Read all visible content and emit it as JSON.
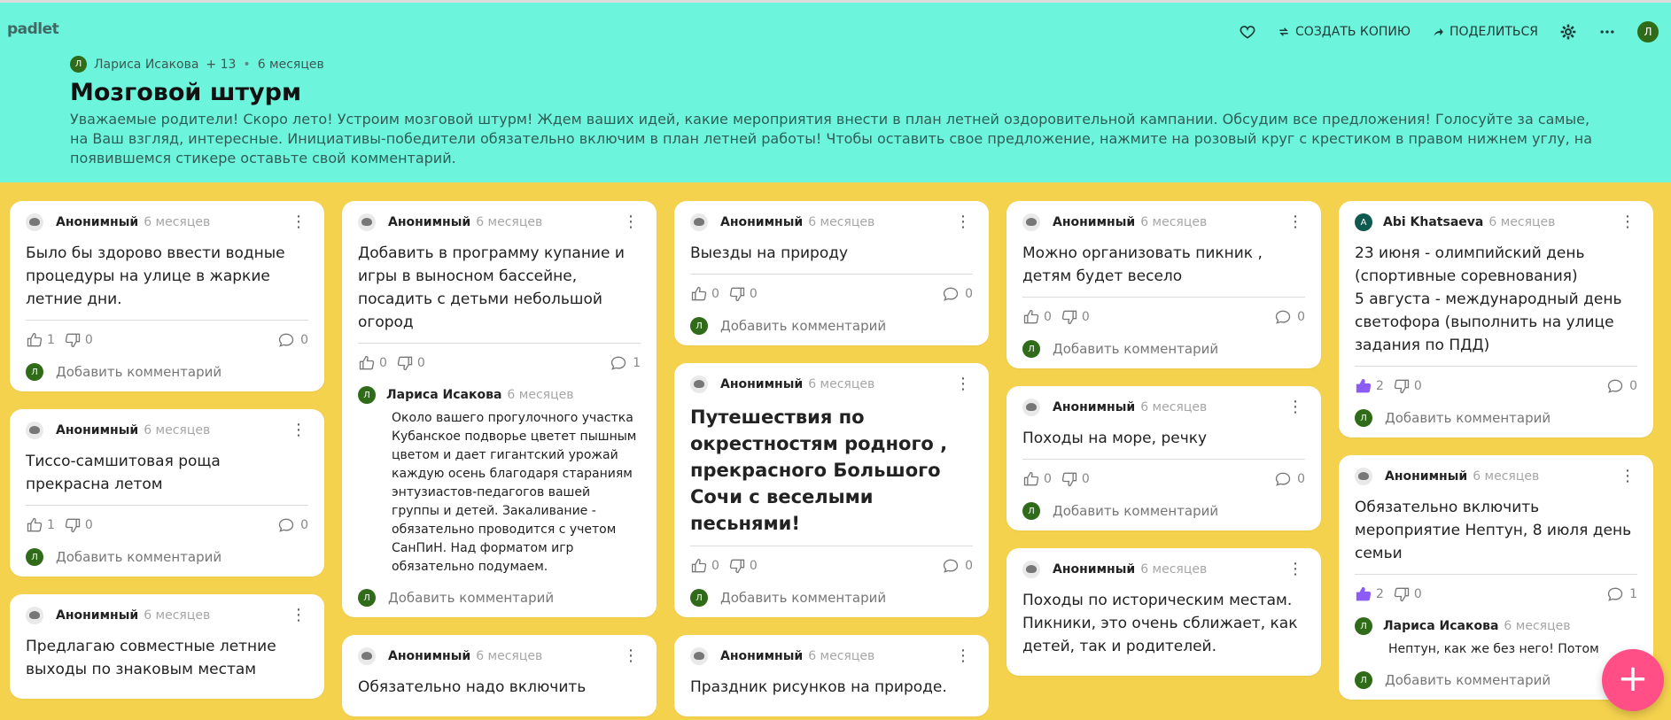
{
  "app": {
    "logo": "padlet"
  },
  "toolbar": {
    "copy_label": "СОЗДАТЬ КОПИЮ",
    "share_label": "ПОДЕЛИТЬСЯ",
    "avatar_letter": "Л"
  },
  "board": {
    "author_initial": "Л",
    "author": "Лариса Исакова",
    "plus_count": "+ 13",
    "age": "6 месяцев",
    "title": "Мозговой штурм",
    "description": "Уважаемые родители! Скоро лето! Устроим мозговой штурм! Ждем ваших идей, какие мероприятия внести в план летней оздоровительной кампании. Обсудим все предложения! Голосуйте за самые, на Ваш взгляд, интересные. Инициативы-победители обязательно включим в план летней работы! Чтобы оставить свое предложение, нажмите на розовый круг с крестиком в правом нижнем углу, на появившемся стикере оставьте свой комментарий."
  },
  "common": {
    "add_comment": "Добавить комментарий",
    "initial": "Л"
  },
  "columns": [
    {
      "cards": [
        {
          "author": "Анонимный",
          "time": "6 месяцев",
          "text": "Было бы здорово ввести водные процедуры на улице в жаркие летние дни.",
          "likes": "1",
          "dislikes": "0",
          "comments": "0"
        },
        {
          "author": "Анонимный",
          "time": "6 месяцев",
          "text": "Тиссо-самшитовая роща прекрасна летом",
          "likes": "1",
          "dislikes": "0",
          "comments": "0"
        },
        {
          "author": "Анонимный",
          "time": "6 месяцев",
          "text": "Предлагаю совместные летние выходы по знаковым местам"
        }
      ]
    },
    {
      "cards": [
        {
          "author": "Анонимный",
          "time": "6 месяцев",
          "text": "Добавить в программу купание и игры в выносном бассейне, посадить с детьми небольшой огород",
          "likes": "0",
          "dislikes": "0",
          "comments": "1",
          "comment": {
            "author": "Лариса Исакова",
            "time": "6 месяцев",
            "text": "Около вашего прогулочного участка Кубанское подворье цветет пышным цветом и дает гигантский урожай каждую осень благодаря стараниям энтузиастов-педагогов вашей группы и детей. Закаливание - обязательно проводится с учетом СанПиН. Над форматом игр обязательно подумаем."
          }
        },
        {
          "author": "Анонимный",
          "time": "6 месяцев",
          "text": "Обязательно надо включить"
        }
      ]
    },
    {
      "cards": [
        {
          "author": "Анонимный",
          "time": "6 месяцев",
          "text": "Выезды на природу",
          "likes": "0",
          "dislikes": "0",
          "comments": "0"
        },
        {
          "author": "Анонимный",
          "time": "6 месяцев",
          "text": "Путешествия по окрестностям родного , прекрасного Большого Сочи с веселыми песьнями!",
          "likes": "0",
          "dislikes": "0",
          "comments": "0"
        },
        {
          "author": "Анонимный",
          "time": "6 месяцев",
          "text": "Праздник рисунков на природе."
        }
      ]
    },
    {
      "cards": [
        {
          "author": "Анонимный",
          "time": "6 месяцев",
          "text": "Можно организовать пикник , детям будет весело",
          "likes": "0",
          "dislikes": "0",
          "comments": "0"
        },
        {
          "author": "Анонимный",
          "time": "6 месяцев",
          "text": "Походы на море, речку",
          "likes": "0",
          "dislikes": "0",
          "comments": "0"
        },
        {
          "author": "Анонимный",
          "time": "6 месяцев",
          "text": "Походы по историческим местам. Пикники, это очень сближает, как детей, так и родителей."
        }
      ]
    },
    {
      "cards": [
        {
          "author": "Abi Khatsaeva",
          "initial": "A",
          "time": "6 месяцев",
          "text": "23 июня - олимпийский день (спортивные соревнования)\n5 августа - международный день светофора (выполнить на улице задания по ПДД)",
          "likes": "2",
          "dislikes": "0",
          "comments": "0"
        },
        {
          "author": "Анонимный",
          "time": "6 месяцев",
          "text": "Обязательно  включить  мероприятие  Нептун,  8 июля  день  семьи",
          "likes": "2",
          "dislikes": "0",
          "comments": "1",
          "comment": {
            "author": "Лариса Исакова",
            "time": "6 месяцев",
            "text": "Нептун, как же без него! Потом"
          }
        }
      ]
    }
  ],
  "fab": {
    "label": "+"
  },
  "colors": {
    "header_bg": "#6df4dd",
    "board_bg": "#f5d24e",
    "fab": "#ff4f86",
    "liked": "#8b5cf6",
    "avatar_green": "#2f6b18",
    "avatar_teal": "#0f5a4f"
  }
}
